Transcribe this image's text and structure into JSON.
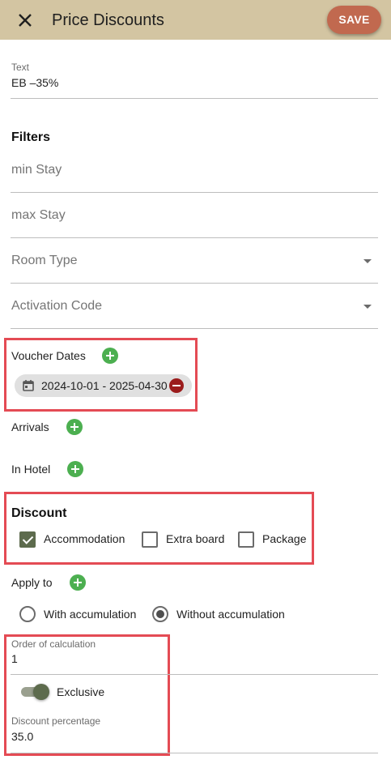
{
  "header": {
    "title": "Price Discounts",
    "save_label": "SAVE",
    "close_icon": "close-icon"
  },
  "text_field": {
    "label": "Text",
    "value": "EB –35%"
  },
  "filters": {
    "title": "Filters",
    "min_stay_placeholder": "min Stay",
    "max_stay_placeholder": "max Stay",
    "room_type_placeholder": "Room Type",
    "activation_code_placeholder": "Activation Code"
  },
  "voucher_dates": {
    "label": "Voucher Dates",
    "chip": "2024-10-01 - 2025-04-30"
  },
  "arrivals": {
    "label": "Arrivals"
  },
  "in_hotel": {
    "label": "In Hotel"
  },
  "discount": {
    "title": "Discount",
    "options": [
      {
        "label": "Accommodation",
        "checked": true
      },
      {
        "label": "Extra board",
        "checked": false
      },
      {
        "label": "Package",
        "checked": false
      }
    ]
  },
  "apply_to": {
    "label": "Apply to"
  },
  "accumulation": {
    "options": [
      {
        "label": "With accumulation",
        "selected": false
      },
      {
        "label": "Without accumulation",
        "selected": true
      }
    ]
  },
  "order_of_calculation": {
    "label": "Order of calculation",
    "value": "1"
  },
  "exclusive": {
    "label": "Exclusive",
    "on": true
  },
  "discount_percentage": {
    "label": "Discount percentage",
    "value": "35.0"
  },
  "colors": {
    "appbar": "#d3c5a2",
    "save_button": "#c1694f",
    "add_button": "#4caf50",
    "remove_button": "#9b1c1c",
    "checkbox_checked": "#5d6b4d",
    "highlight_border": "#e44b54"
  }
}
